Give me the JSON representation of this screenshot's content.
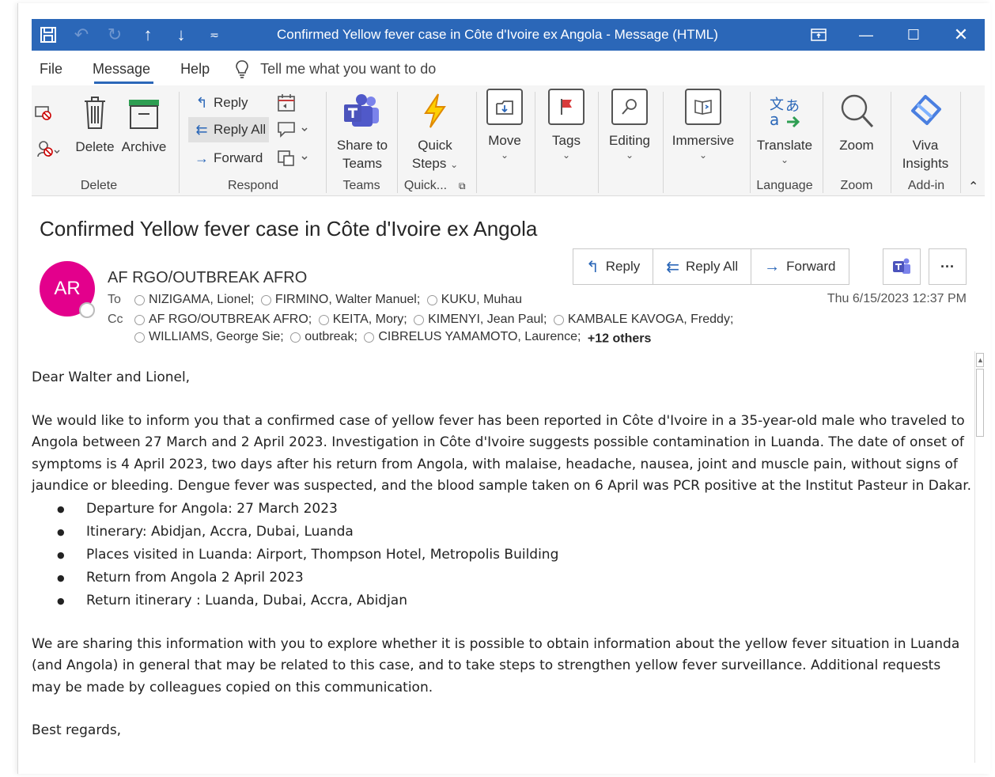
{
  "window": {
    "title": "Confirmed Yellow fever case in Côte d'Ivoire ex Angola  -  Message (HTML)",
    "accent": "#2b67b8"
  },
  "menu": {
    "tabs": [
      "File",
      "Message",
      "Help"
    ],
    "active_tab": "Message",
    "tell_me": "Tell me what you want to do"
  },
  "ribbon": {
    "delete_group": {
      "label": "Delete",
      "delete": "Delete",
      "archive": "Archive"
    },
    "respond_group": {
      "label": "Respond",
      "reply": "Reply",
      "reply_all": "Reply All",
      "forward": "Forward"
    },
    "teams_group": {
      "label": "Teams",
      "share_line1": "Share to",
      "share_line2": "Teams"
    },
    "quick_group": {
      "label": "Quick...",
      "line1": "Quick",
      "line2": "Steps"
    },
    "move": "Move",
    "tags": "Tags",
    "editing": "Editing",
    "immersive": "Immersive",
    "language_group": {
      "label": "Language",
      "translate": "Translate"
    },
    "zoom_group": {
      "label": "Zoom",
      "zoom": "Zoom"
    },
    "addin_group": {
      "label": "Add-in",
      "line1": "Viva",
      "line2": "Insights"
    }
  },
  "message": {
    "subject": "Confirmed Yellow fever case in Côte d'Ivoire ex Angola",
    "avatar_initials": "AR",
    "avatar_color": "#e3008c",
    "sender": "AF RGO/OUTBREAK AFRO",
    "to_label": "To",
    "cc_label": "Cc",
    "to": [
      "NIZIGAMA, Lionel;",
      "FIRMINO, Walter Manuel;",
      "KUKU, Muhau"
    ],
    "cc_line1": [
      "AF RGO/OUTBREAK AFRO;",
      "KEITA, Mory;",
      "KIMENYI, Jean Paul;",
      "KAMBALE KAVOGA, Freddy;"
    ],
    "cc_line2": [
      "WILLIAMS, George Sie;",
      "outbreak;",
      "CIBRELUS YAMAMOTO, Laurence;"
    ],
    "others": "+12 others",
    "date": "Thu 6/15/2023 12:37 PM",
    "actions": {
      "reply": "Reply",
      "reply_all": "Reply All",
      "forward": "Forward",
      "more": "···"
    }
  },
  "body": {
    "greeting": "Dear Walter and Lionel,",
    "paragraph1": "We would like to inform you that a confirmed case of yellow fever has been reported in Côte d'Ivoire in a 35-year-old male who traveled to Angola between 27 March and 2 April 2023. Investigation in Côte d'Ivoire suggests possible contamination in Luanda. The date of onset of symptoms is 4 April 2023, two days after his return from Angola, with malaise, headache, nausea, joint and muscle pain, without signs of jaundice or bleeding. Dengue fever was suspected, and the blood sample taken on 6 April was PCR positive at the Institut Pasteur in Dakar.",
    "bullets": [
      "Departure for Angola: 27 March 2023",
      "Itinerary: Abidjan, Accra, Dubai, Luanda",
      "Places visited in Luanda: Airport, Thompson Hotel, Metropolis Building",
      "Return from Angola 2 April 2023",
      "Return itinerary : Luanda, Dubai, Accra, Abidjan"
    ],
    "paragraph2": "We are sharing this information with you to explore whether it is possible to obtain information about the yellow fever situation in Luanda (and Angola) in general that may be related to this case, and to take steps to strengthen yellow fever surveillance. Additional requests may be made by colleagues copied on this communication.",
    "closing": "Best regards,"
  }
}
